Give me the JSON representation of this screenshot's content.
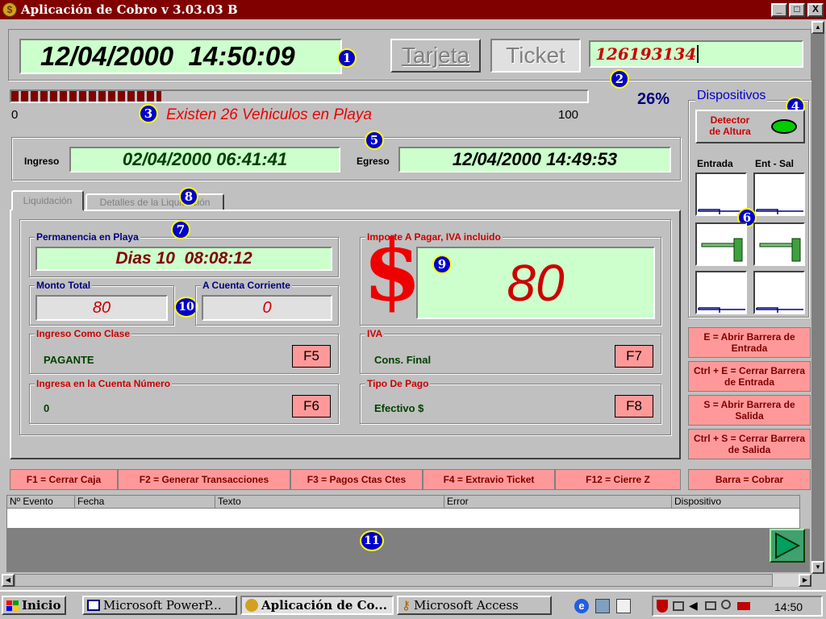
{
  "window": {
    "title": "Aplicación de Cobro v 3.03.03 B",
    "controls": {
      "minimize": "_",
      "maximize": "□",
      "close": "X"
    }
  },
  "clock": {
    "datetime": "12/04/2000  14:50:09"
  },
  "mode_buttons": {
    "tarjeta": "Tarjeta",
    "ticket": "Ticket"
  },
  "ticket_input": {
    "value": "126193134"
  },
  "occupancy": {
    "min": "0",
    "max": "100",
    "percent": "26%",
    "fraction": 0.26,
    "message": "Existen 26 Vehiculos en Playa"
  },
  "times": {
    "ingreso_label": "Ingreso",
    "ingreso_value": "02/04/2000 06:41:41",
    "egreso_label": "Egreso",
    "egreso_value": "12/04/2000 14:49:53"
  },
  "tabs": [
    {
      "label": "Liquidación",
      "active": true
    },
    {
      "label": "Detalles de la Liquidación",
      "active": false
    }
  ],
  "liquidacion": {
    "permanencia_label": "Permanencia en Playa",
    "permanencia_value": "Dias 10  08:08:12",
    "monto_total_label": "Monto Total",
    "monto_total_value": "80",
    "cuenta_corriente_label": "A Cuenta Corriente",
    "cuenta_corriente_value": "0",
    "importe_label": "Importe A Pagar, IVA incluido",
    "currency_symbol": "$",
    "importe_value": "80",
    "clase_label": "Ingreso Como Clase",
    "clase_value": "PAGANTE",
    "clase_key": "F5",
    "cuenta_num_label": "Ingresa en la Cuenta Número",
    "cuenta_num_value": "0",
    "cuenta_num_key": "F6",
    "iva_label": "IVA",
    "iva_value": "Cons. Final",
    "iva_key": "F7",
    "tipo_pago_label": "Tipo De Pago",
    "tipo_pago_value": "Efectivo $",
    "tipo_pago_key": "F8"
  },
  "dispositivos": {
    "title": "Dispositivos",
    "detector_label": "Detector de Altura",
    "detector_color": "#00cc00",
    "col_entrada": "Entrada",
    "col_ent_sal": "Ent - Sal"
  },
  "barrier_hints": [
    "E = Abrir Barrera de Entrada",
    "Ctrl + E = Cerrar Barrera de Entrada",
    "S = Abrir Barrera  de Salida",
    "Ctrl  + S = Cerrar Barrera de Salida"
  ],
  "function_keys": [
    "F1 = Cerrar Caja",
    "F2 = Generar Transacciones",
    "F3 = Pagos Ctas Ctes",
    "F4 = Extravio Ticket",
    "F12 = Cierre Z"
  ],
  "cobrar_key": "Barra = Cobrar",
  "event_grid": {
    "columns": [
      "Nº Evento",
      "Fecha",
      "Texto",
      "Error",
      "Dispositivo"
    ]
  },
  "badges": [
    "1",
    "2",
    "3",
    "4",
    "5",
    "6",
    "7",
    "8",
    "9",
    "10",
    "11"
  ],
  "taskbar": {
    "start": "Inicio",
    "items": [
      {
        "label": "Microsoft PowerP...",
        "active": false
      },
      {
        "label": "Aplicación de Co...",
        "active": true
      },
      {
        "label": "Microsoft Access",
        "active": false
      }
    ],
    "clock": "14:50"
  },
  "colors": {
    "title_bar": "#800000",
    "field_green": "#ccffcc",
    "fkey_pink": "#ff9999",
    "amount_red": "#cc0000",
    "progress": "#800000"
  }
}
